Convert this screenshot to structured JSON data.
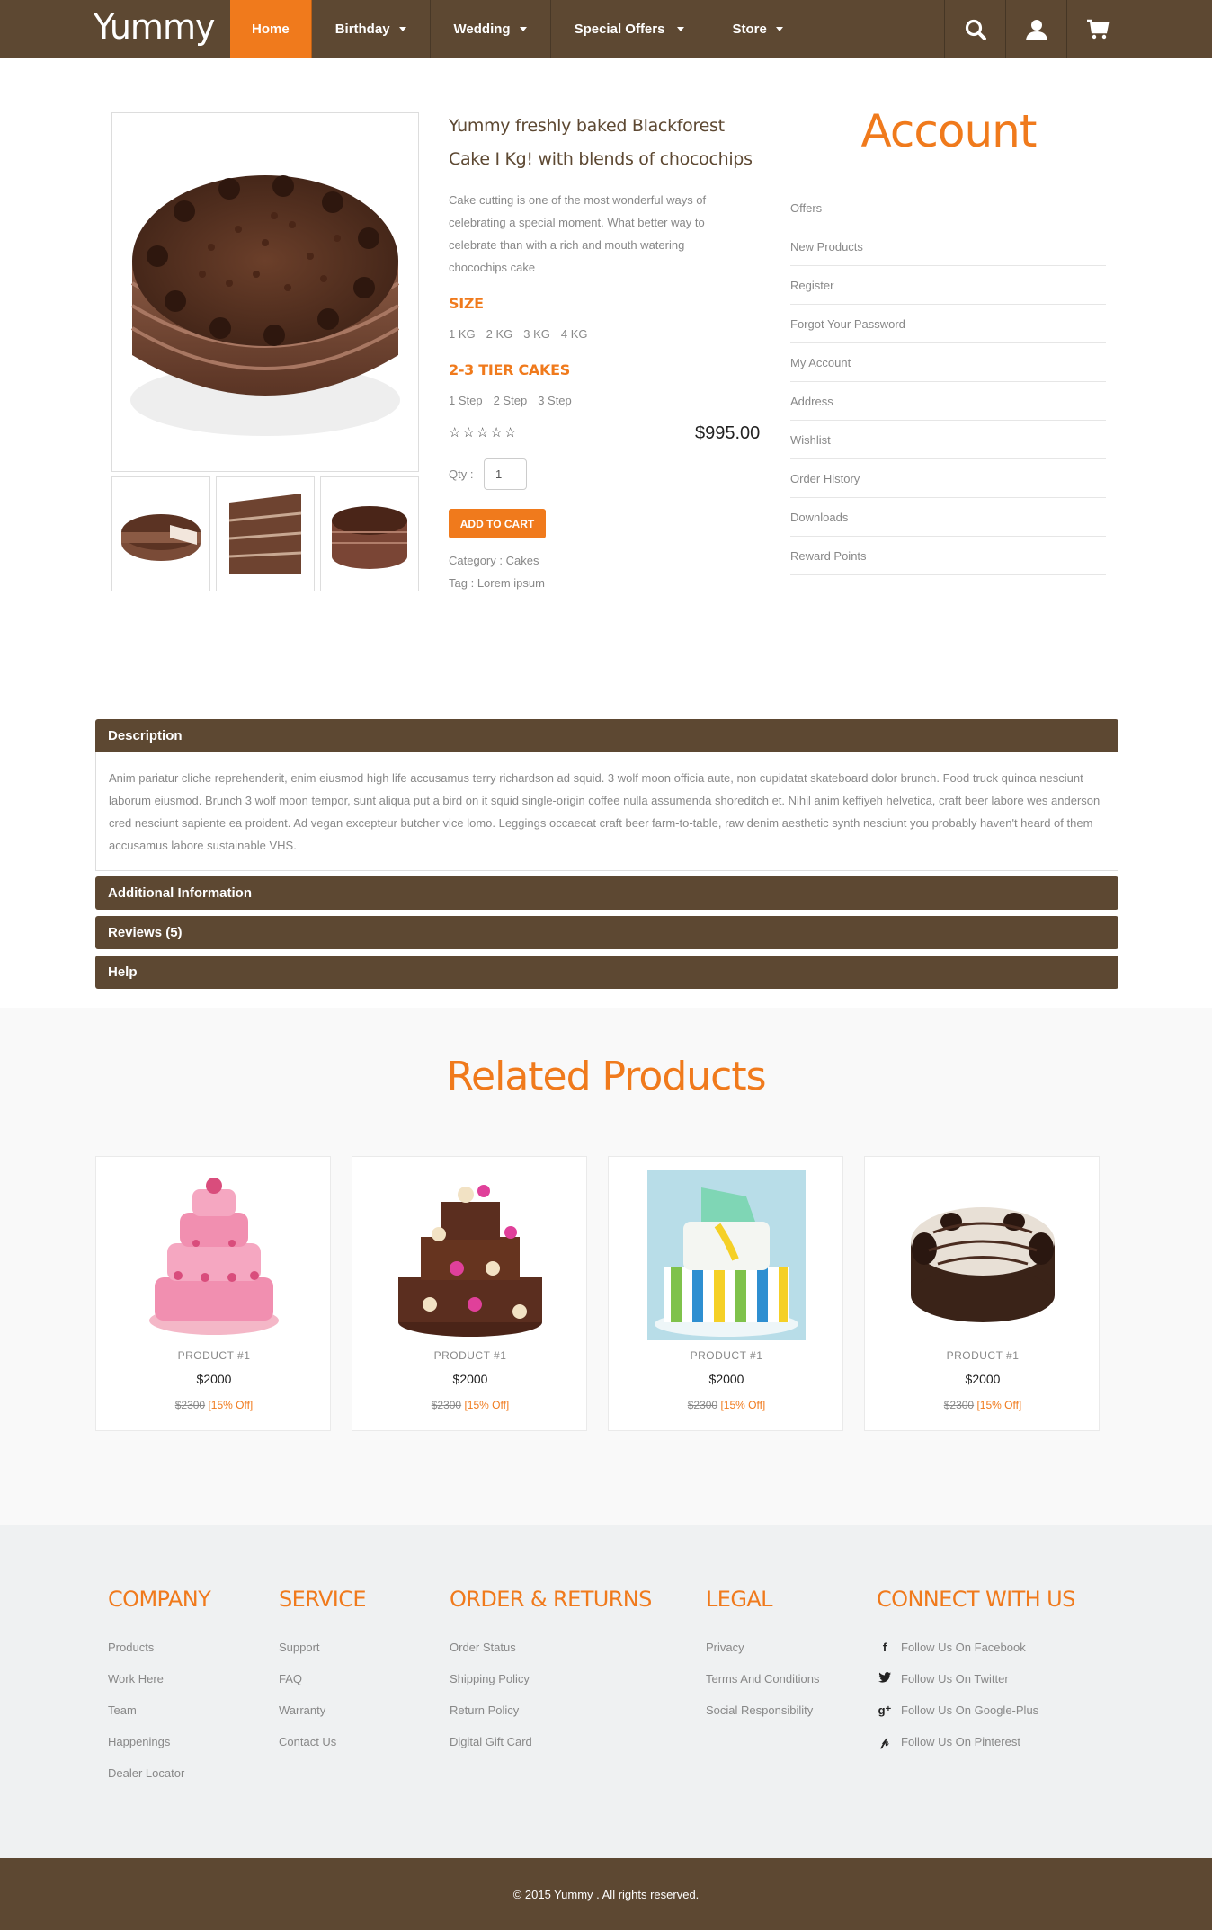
{
  "brand": "Yummy",
  "nav": {
    "items": [
      {
        "label": "Home"
      },
      {
        "label": "Birthday"
      },
      {
        "label": "Wedding"
      },
      {
        "label": "Special Offers"
      },
      {
        "label": "Store"
      }
    ],
    "icons": [
      "search-icon",
      "user-icon",
      "cart-icon"
    ]
  },
  "product": {
    "title": "Yummy freshly baked Blackforest Cake I Kg! with blends of chocochips",
    "description": "Cake cutting is one of the most wonderful ways of celebrating a special moment. What better way to celebrate than with a rich and mouth watering chocochips cake",
    "size_label": "SIZE",
    "sizes": [
      "1 KG",
      "2 KG",
      "3 KG",
      "4 KG"
    ],
    "tier_label": "2-3 TIER CAKES",
    "tiers": [
      "1 Step",
      "2 Step",
      "3 Step"
    ],
    "rating": 0,
    "rating_max": 5,
    "price": "$995.00",
    "qty_label": "Qty :",
    "qty_value": "1",
    "add_to_cart": "ADD TO CART",
    "category_label": "Category :",
    "category_value": "Cakes",
    "tag_label": "Tag :",
    "tag_value": "Lorem ipsum"
  },
  "account": {
    "title": "Account",
    "links": [
      "Offers",
      "New Products",
      "Register",
      "Forgot Your Password",
      "My Account",
      "Address",
      "Wishlist",
      "Order History",
      "Downloads",
      "Reward Points"
    ]
  },
  "tabs": {
    "description": {
      "label": "Description",
      "body": "Anim pariatur cliche reprehenderit, enim eiusmod high life accusamus terry richardson ad squid. 3 wolf moon officia aute, non cupidatat skateboard dolor brunch. Food truck quinoa nesciunt laborum eiusmod. Brunch 3 wolf moon tempor, sunt aliqua put a bird on it squid single-origin coffee nulla assumenda shoreditch et. Nihil anim keffiyeh helvetica, craft beer labore wes anderson cred nesciunt sapiente ea proident. Ad vegan excepteur butcher vice lomo. Leggings occaecat craft beer farm-to-table, raw denim aesthetic synth nesciunt you probably haven't heard of them accusamus labore sustainable VHS."
    },
    "additional": {
      "label": "Additional Information"
    },
    "reviews": {
      "label": "Reviews (5)"
    },
    "help": {
      "label": "Help"
    }
  },
  "related": {
    "title": "Related Products",
    "items": [
      {
        "name": "PRODUCT #1",
        "price": "$2000",
        "old_price": "$2300",
        "discount": "[15% Off]"
      },
      {
        "name": "PRODUCT #1",
        "price": "$2000",
        "old_price": "$2300",
        "discount": "[15% Off]"
      },
      {
        "name": "PRODUCT #1",
        "price": "$2000",
        "old_price": "$2300",
        "discount": "[15% Off]"
      },
      {
        "name": "PRODUCT #1",
        "price": "$2000",
        "old_price": "$2300",
        "discount": "[15% Off]"
      }
    ]
  },
  "footer": {
    "company": {
      "title": "COMPANY",
      "links": [
        "Products",
        "Work Here",
        "Team",
        "Happenings",
        "Dealer Locator"
      ]
    },
    "service": {
      "title": "SERVICE",
      "links": [
        "Support",
        "FAQ",
        "Warranty",
        "Contact Us"
      ]
    },
    "orders": {
      "title": "ORDER & RETURNS",
      "links": [
        "Order Status",
        "Shipping Policy",
        "Return Policy",
        "Digital Gift Card"
      ]
    },
    "legal": {
      "title": "LEGAL",
      "links": [
        "Privacy",
        "Terms And Conditions",
        "Social Responsibility"
      ]
    },
    "connect": {
      "title": "CONNECT WITH US",
      "links": [
        {
          "icon": "facebook-icon",
          "label": "Follow Us On Facebook"
        },
        {
          "icon": "twitter-icon",
          "label": "Follow Us On Twitter"
        },
        {
          "icon": "google-plus-icon",
          "label": "Follow Us On Google-Plus"
        },
        {
          "icon": "pinterest-icon",
          "label": "Follow Us On Pinterest"
        }
      ]
    },
    "copyright": "© 2015 Yummy . All rights reserved."
  },
  "colors": {
    "brown": "#5d4832",
    "orange": "#f07a1c",
    "footer_bg": "#eff1f2"
  }
}
